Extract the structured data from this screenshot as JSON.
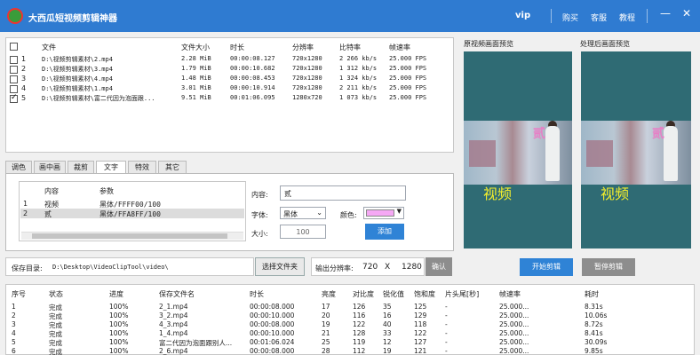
{
  "app": {
    "title": "大西瓜短视频剪辑神器",
    "vip": "vip",
    "buy": "购买",
    "service": "客服",
    "tutorial": "教程"
  },
  "files": {
    "headers": [
      "文件",
      "文件大小",
      "时长",
      "分辨率",
      "比特率",
      "帧速率"
    ],
    "rows": [
      {
        "num": "1",
        "checked": false,
        "file": "D:\\视频剪辑素材\\2.mp4",
        "size": "2.28 MiB",
        "dur": "00:00:08.127",
        "res": "720x1280",
        "bitrate": "2 266 kb/s",
        "fps": "25.000 FPS"
      },
      {
        "num": "2",
        "checked": false,
        "file": "D:\\视频剪辑素材\\3.mp4",
        "size": "1.79 MiB",
        "dur": "00:00:10.682",
        "res": "720x1280",
        "bitrate": "1 312 kb/s",
        "fps": "25.000 FPS"
      },
      {
        "num": "3",
        "checked": false,
        "file": "D:\\视频剪辑素材\\4.mp4",
        "size": "1.48 MiB",
        "dur": "00:00:08.453",
        "res": "720x1280",
        "bitrate": "1 324 kb/s",
        "fps": "25.000 FPS"
      },
      {
        "num": "4",
        "checked": false,
        "file": "D:\\视频剪辑素材\\1.mp4",
        "size": "3.01 MiB",
        "dur": "00:00:10.914",
        "res": "720x1280",
        "bitrate": "2 211 kb/s",
        "fps": "25.000 FPS"
      },
      {
        "num": "5",
        "checked": true,
        "file": "D:\\视频剪辑素材\\富二代因为泡面跟...",
        "size": "9.51 MiB",
        "dur": "00:01:06.095",
        "res": "1280x720",
        "bitrate": "1 073 kb/s",
        "fps": "25.000 FPS"
      }
    ]
  },
  "tabs": [
    "调色",
    "画中画",
    "裁剪",
    "文字",
    "特效",
    "其它"
  ],
  "textTab": {
    "headers": [
      "内容",
      "参数"
    ],
    "rows": [
      {
        "num": "1",
        "content": "视频",
        "param": "黑体/FFFF00/100"
      },
      {
        "num": "2",
        "content": "贰",
        "param": "黑体/FFA8FF/100"
      }
    ],
    "content_label": "内容:",
    "content_value": "贰",
    "font_label": "字体:",
    "font_value": "黑体",
    "color_label": "颜色:",
    "color_value": "#F5A8F5",
    "size_label": "大小:",
    "size_value": "100",
    "add_label": "添加"
  },
  "output": {
    "dir_label": "保存目录:",
    "dir_value": "D:\\Desktop\\VideoClipTool\\video\\",
    "choose_label": "选择文件夹",
    "res_label": "输出分辨率:",
    "res_w": "720",
    "res_x": "X",
    "res_h": "1280",
    "confirm_label": "确认"
  },
  "preview": {
    "original_label": "原视频画面预览",
    "processed_label": "处理后画面预览",
    "caption_top": "贰",
    "caption_bottom": "视频",
    "start_label": "开始剪辑",
    "pause_label": "暂停剪辑"
  },
  "tasks": {
    "headers": [
      "序号",
      "状态",
      "进度",
      "保存文件名",
      "时长",
      "亮度",
      "对比度",
      "锐化值",
      "饱和度",
      "片头尾[秒]",
      "帧速率",
      "耗时"
    ],
    "rows": [
      [
        "1",
        "完成",
        "100%",
        "2_1.mp4",
        "00:00:08.000",
        "17",
        "126",
        "35",
        "125",
        "-",
        "25.000...",
        "8.31s"
      ],
      [
        "2",
        "完成",
        "100%",
        "3_2.mp4",
        "00:00:10.000",
        "20",
        "116",
        "16",
        "129",
        "-",
        "25.000...",
        "10.06s"
      ],
      [
        "3",
        "完成",
        "100%",
        "4_3.mp4",
        "00:00:08.000",
        "19",
        "122",
        "40",
        "118",
        "-",
        "25.000...",
        "8.72s"
      ],
      [
        "4",
        "完成",
        "100%",
        "1_4.mp4",
        "00:00:10.000",
        "21",
        "128",
        "33",
        "122",
        "-",
        "25.000...",
        "8.41s"
      ],
      [
        "5",
        "完成",
        "100%",
        "富二代因为泡面跟别人...",
        "00:01:06.024",
        "25",
        "119",
        "12",
        "127",
        "-",
        "25.000...",
        "30.09s"
      ],
      [
        "6",
        "完成",
        "100%",
        "2_6.mp4",
        "00:00:08.000",
        "28",
        "112",
        "19",
        "121",
        "-",
        "25.000...",
        "9.85s"
      ]
    ]
  }
}
